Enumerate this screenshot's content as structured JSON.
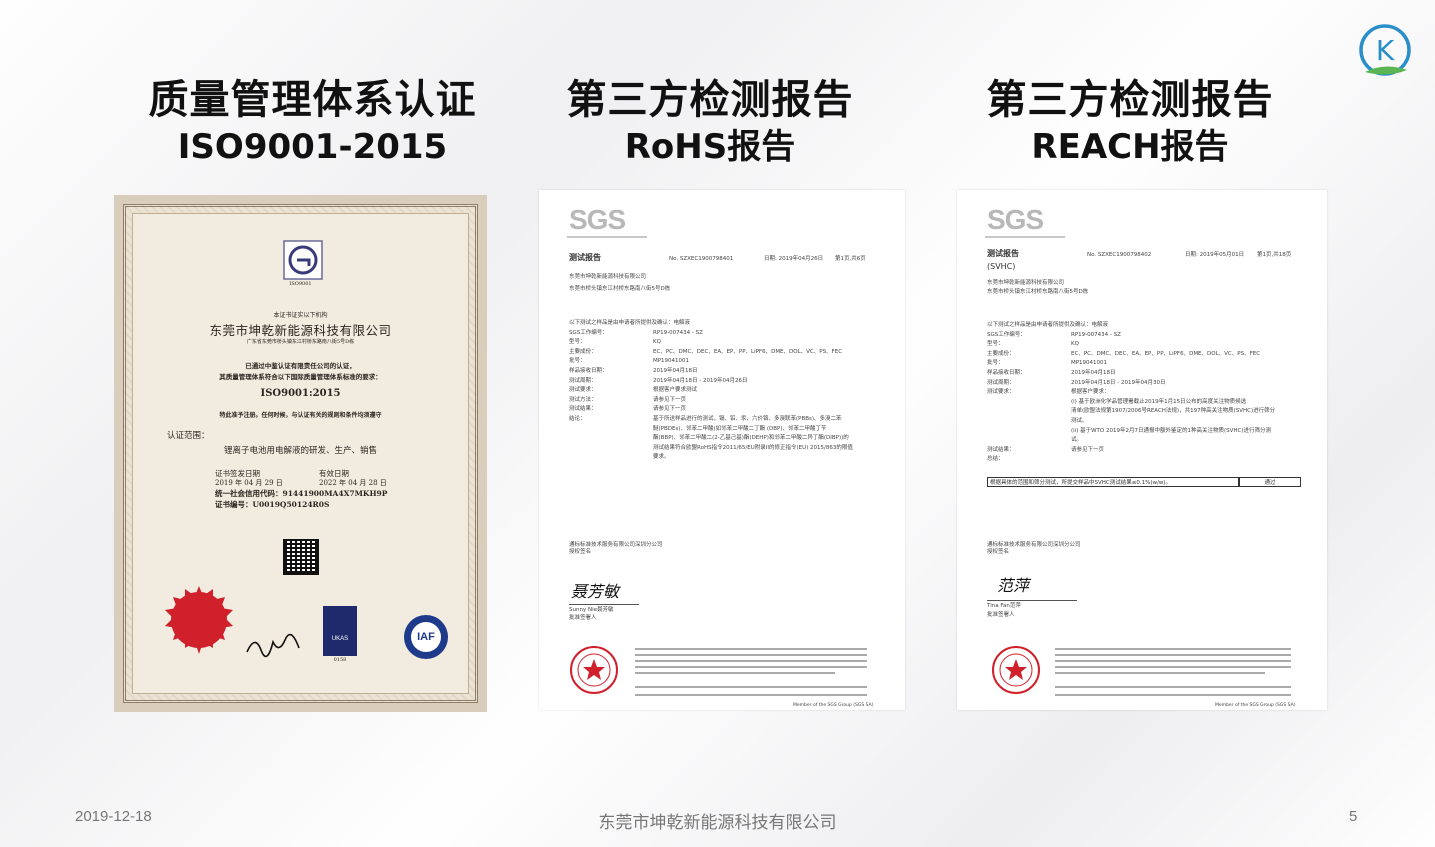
{
  "slide": {
    "heading1": {
      "line1": "质量管理体系认证",
      "line2": "ISO9001-2015"
    },
    "heading2": {
      "line1": "第三方检测报告",
      "line2": "RoHS报告"
    },
    "heading3": {
      "line1": "第三方检测报告",
      "line2": "REACH报告"
    },
    "logo_letter": "K",
    "brand_color": "#2a8fc9",
    "brand_green": "#5ab552"
  },
  "certificate": {
    "logo_caption": "ISO9001",
    "intro": "本证书证实以下机构",
    "company": "东莞市坤乾新能源科技有限公司",
    "address": "广东省东莞市桥头镇东江村桥东路南八街5号D栋",
    "statement1": "已通过中鉴认证有限责任公司的认证，",
    "statement2": "其质量管理体系符合以下国际质量管理体系标准的要求：",
    "standard": "ISO9001:2015",
    "grant": "特此准予注册。任何时候，与认证有关的规则和条件均须遵守",
    "scope_label": "认证范围：",
    "scope": "锂离子电池用电解液的研发、生产、销售",
    "issue_label": "证书签发日期",
    "issue_date": "2019 年 04 月 29 日",
    "valid_label": "有效日期",
    "valid_date": "2022 年 04 月 28 日",
    "credit_code": "统一社会信用代码：91441900MA4X7MKH9P",
    "cert_no": "证书编号：U0019Q50124R0S",
    "ukas_label": "UKAS",
    "ukas_no": "0158",
    "iaf_label": "IAF"
  },
  "rohs": {
    "logo": "SGS",
    "title": "测试报告",
    "report_no": "No. SZXEC1900798401",
    "date": "日期: 2019年04月26日",
    "page": "第1页,共6页",
    "client": "东莞市坤乾新能源科技有限公司",
    "client_addr": "东莞市桥头镇东江村桥东路南八街5号D栋",
    "rows": [
      [
        "以下测试之样品是由申请者所提供及确认：电解液",
        ""
      ],
      [
        "SGS工作编号：",
        "RP19-007434 - SZ"
      ],
      [
        "型号：",
        "KQ"
      ],
      [
        "主要成份：",
        "EC、PC、DMC、DEC、EA、EP、PP、LiPF6、DME、DOL、VC、PS、FEC"
      ],
      [
        "批号：",
        "MP19041001"
      ],
      [
        "样品接收日期：",
        "2019年04月18日"
      ],
      [
        "测试周期：",
        "2019年04月18日 - 2019年04月26日"
      ],
      [
        "测试要求：",
        "根据客户要求测试"
      ],
      [
        "测试方法：",
        "请参见下一页"
      ],
      [
        "测试结果：",
        "请参见下一页"
      ],
      [
        "结论：",
        "基于所送样品进行的测试，镉、铅、汞、六价铬、多溴联苯(PBBs)、多溴二苯"
      ],
      [
        "",
        "醚(PBDEs)、邻苯二甲酸(如邻苯二甲酸二丁酯 (DBP)、邻苯二甲酸丁苄"
      ],
      [
        "",
        "酯(BBP)、邻苯二甲酸二(2-乙基己基)酯(DEHP)和邻苯二甲酸二异丁酯(DIBP))的"
      ],
      [
        "",
        "测试结果符合欧盟RoHS指令2011/65/EU附录II的修正指令(EU) 2015/863的限值"
      ],
      [
        "",
        "要求。"
      ]
    ],
    "lab": "通标标准技术服务有限公司深圳分公司",
    "lab_sign": "授权签名",
    "signature": "聂芳敏",
    "signer": "Sunny Nie聂芳敏",
    "signer_title": "批准签署人",
    "member": "Member of the SGS Group (SGS SA)"
  },
  "reach": {
    "logo": "SGS",
    "title": "测试报告",
    "subtitle": "(SVHC)",
    "report_no": "No. SZXEC1900798402",
    "date": "日期: 2019年05月01日",
    "page": "第1页,共18页",
    "client": "东莞市坤乾新能源科技有限公司",
    "client_addr": "东莞市桥头镇东江村桥东路南八街5号D栋",
    "rows": [
      [
        "以下测试之样品是由申请者所提供及确认：电解液",
        ""
      ],
      [
        "SGS工作编号：",
        "RP19-007434 - SZ"
      ],
      [
        "型号：",
        "KQ"
      ],
      [
        "主要成份：",
        "EC、PC、DMC、DEC、EA、EP、PP、LiPF6、DME、DOL、VC、PS、FEC"
      ],
      [
        "批号：",
        "MP19041001"
      ],
      [
        "样品接收日期：",
        "2019年04月18日"
      ],
      [
        "测试周期：",
        "2019年04月18日 - 2019年04月30日"
      ],
      [
        "测试要求：",
        "根据客户要求："
      ],
      [
        "",
        "(i) 基于欧洲化学品管理署截止2019年1月15日公布的高度关注物质候选"
      ],
      [
        "",
        "清单(欧盟法规第1907/2006号REACH法规)，共197种高关注物质(SVHC)进行筛分"
      ],
      [
        "",
        "测试。"
      ],
      [
        "",
        "(ii) 基于WTO 2019年2月7日通报中额外鉴定的1种高关注物质(SVHC)进行筛分测"
      ],
      [
        "",
        "试。"
      ],
      [
        "测试结果：",
        "请参见下一页"
      ],
      [
        "总结：",
        ""
      ]
    ],
    "summary_text": "根据具体的范围和筛分测试，所提交样品中SVHC测试结果≤0.1%(w/w)。",
    "summary_result": "通过",
    "lab": "通标标准技术服务有限公司深圳分公司",
    "lab_sign": "授权签名",
    "signature": "范萍",
    "signer": "Tina Fan范萍",
    "signer_title": "批准签署人",
    "member": "Member of the SGS Group (SGS SA)"
  },
  "footer": {
    "date": "2019-12-18",
    "company": "东莞市坤乾新能源科技有限公司",
    "page": "5"
  }
}
